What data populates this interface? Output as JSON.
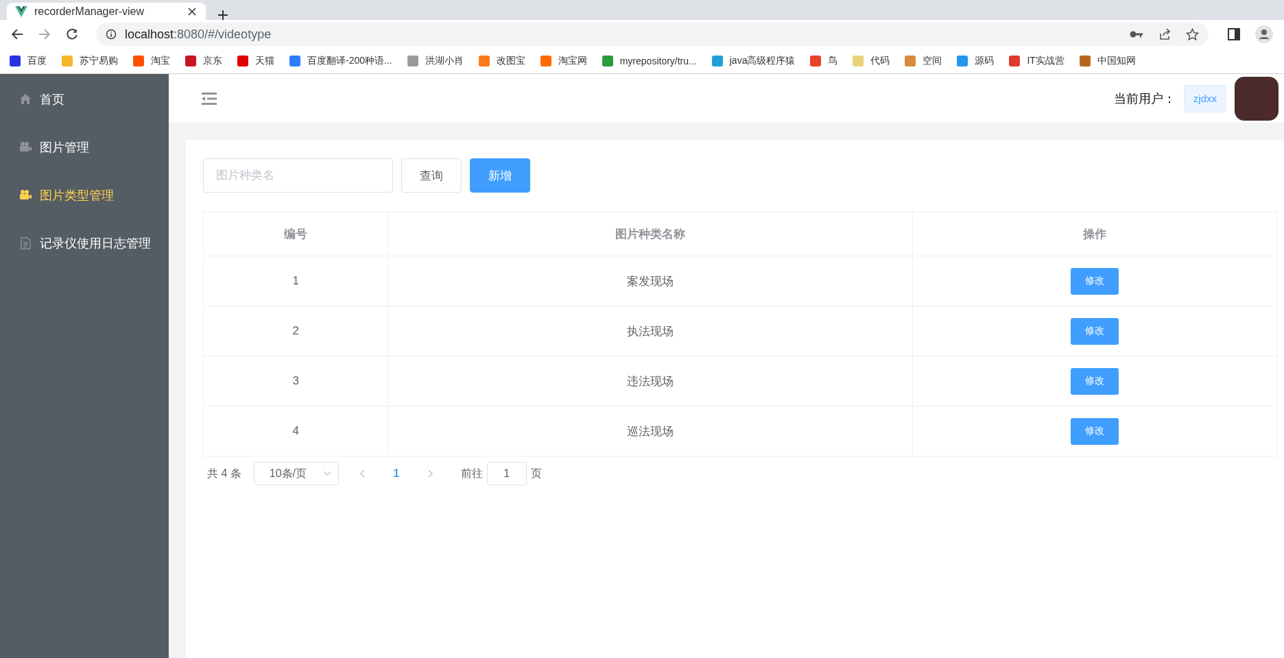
{
  "browser": {
    "tab_title": "recorderManager-view",
    "url_host": "localhost",
    "url_rest": ":8080/#/videotype",
    "bookmarks": [
      {
        "label": "百度",
        "color": "#2932e1"
      },
      {
        "label": "苏宁易购",
        "color": "#f7b52c"
      },
      {
        "label": "淘宝",
        "color": "#ff5000"
      },
      {
        "label": "京东",
        "color": "#c91623"
      },
      {
        "label": "天猫",
        "color": "#e00000"
      },
      {
        "label": "百度翻译-200种语...",
        "color": "#2c7ef8"
      },
      {
        "label": "洪湖小肖",
        "color": "#9a9a9a"
      },
      {
        "label": "改图宝",
        "color": "#ff7a1a"
      },
      {
        "label": "淘宝网",
        "color": "#ff6a00"
      },
      {
        "label": "myrepository/tru...",
        "color": "#2a9d3c"
      },
      {
        "label": "java高级程序猿",
        "color": "#20a0d8"
      },
      {
        "label": "鸟",
        "color": "#e8442c"
      },
      {
        "label": "代码",
        "color": "#e9d27a"
      },
      {
        "label": "空间",
        "color": "#d98a3c"
      },
      {
        "label": "源码",
        "color": "#2496ed"
      },
      {
        "label": "IT实战营",
        "color": "#e03a2c"
      },
      {
        "label": "中国知网",
        "color": "#b5651d"
      }
    ]
  },
  "sidebar": {
    "items": [
      {
        "label": "首页",
        "selected": false
      },
      {
        "label": "图片管理",
        "selected": false
      },
      {
        "label": "图片类型管理",
        "selected": true
      },
      {
        "label": "记录仪使用日志管理",
        "selected": false
      }
    ]
  },
  "header": {
    "user_label": "当前用户：",
    "username": "zjdxx"
  },
  "search": {
    "placeholder": "图片种类名",
    "buttons": [
      {
        "label": "查询",
        "kind": "plain"
      },
      {
        "label": "新增",
        "kind": "primary"
      }
    ]
  },
  "table": {
    "columns": [
      "编号",
      "图片种类名称",
      "操作"
    ],
    "rows": [
      {
        "id": "1",
        "name": "案发现场",
        "action": "修改"
      },
      {
        "id": "2",
        "name": "执法现场",
        "action": "修改"
      },
      {
        "id": "3",
        "name": "违法现场",
        "action": "修改"
      },
      {
        "id": "4",
        "name": "巡法现场",
        "action": "修改"
      }
    ]
  },
  "pagination": {
    "total": "共 4 条",
    "page_size": "10条/页",
    "pages": [
      {
        "label": "1",
        "selected": true
      }
    ],
    "goto_label": "前往",
    "goto_value": "1",
    "goto_suffix": "页"
  }
}
